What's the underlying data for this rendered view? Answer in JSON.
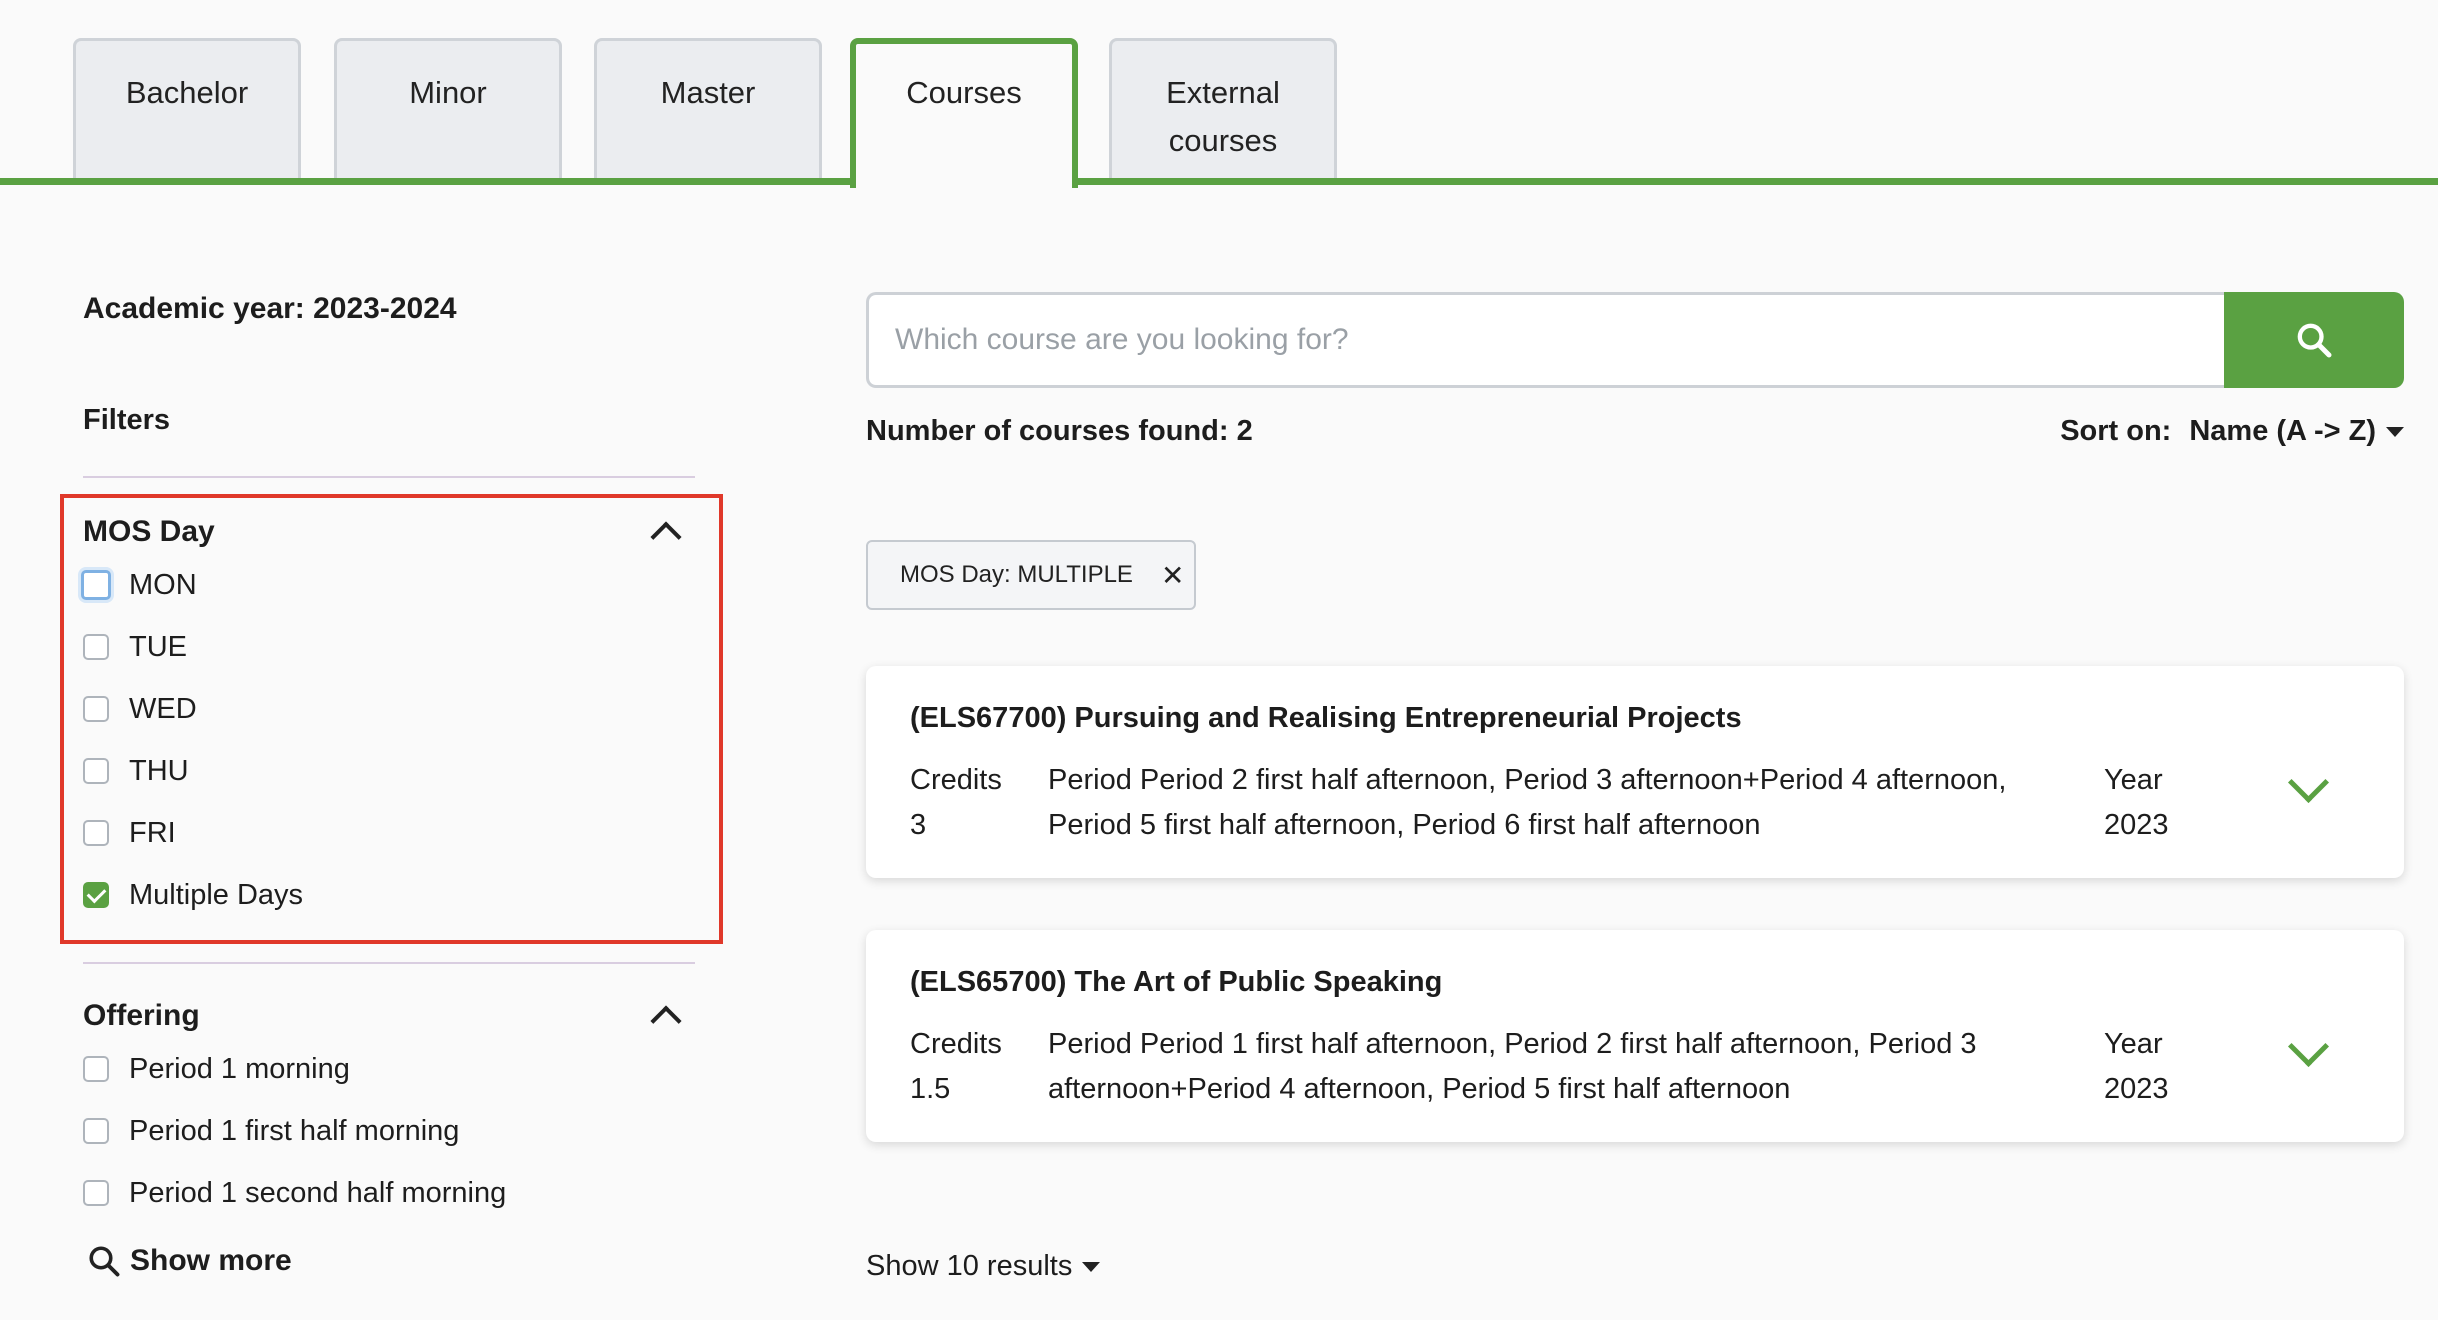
{
  "tabs": [
    {
      "label": "Bachelor"
    },
    {
      "label": "Minor"
    },
    {
      "label": "Master"
    },
    {
      "label": "Courses"
    },
    {
      "label": "External courses"
    }
  ],
  "active_tab": "Courses",
  "academic_year": "Academic year: 2023-2024",
  "filters_title": "Filters",
  "mos_day": {
    "title": "MOS Day",
    "options": [
      {
        "label": "MON",
        "checked": false
      },
      {
        "label": "TUE",
        "checked": false
      },
      {
        "label": "WED",
        "checked": false
      },
      {
        "label": "THU",
        "checked": false
      },
      {
        "label": "FRI",
        "checked": false
      },
      {
        "label": "Multiple Days",
        "checked": true
      }
    ]
  },
  "offering": {
    "title": "Offering",
    "options": [
      {
        "label": "Period 1 morning",
        "checked": false
      },
      {
        "label": "Period 1 first half morning",
        "checked": false
      },
      {
        "label": "Period 1 second half morning",
        "checked": false
      }
    ],
    "show_more": "Show more"
  },
  "search": {
    "placeholder": "Which course are you looking for?",
    "value": ""
  },
  "results_count": "Number of courses found: 2",
  "sort": {
    "label": "Sort on:",
    "value": "Name (A -> Z)"
  },
  "active_filter_chip": "MOS Day: MULTIPLE",
  "courses": [
    {
      "title": "(ELS67700) Pursuing and Realising Entrepreneurial Projects",
      "credits_label": "Credits",
      "credits": "3",
      "period_line1": "Period Period 2 first half afternoon, Period 3 afternoon+Period 4 afternoon,",
      "period_line2": "Period 5 first half afternoon, Period 6 first half afternoon",
      "year_label": "Year",
      "year": "2023"
    },
    {
      "title": "(ELS65700) The Art of Public Speaking",
      "credits_label": "Credits",
      "credits": "1.5",
      "period_line1": "Period Period 1 first half afternoon, Period 2 first half afternoon, Period 3",
      "period_line2": "afternoon+Period 4 afternoon, Period 5 first half afternoon",
      "year_label": "Year",
      "year": "2023"
    }
  ],
  "show_results": "Show 10 results",
  "colors": {
    "accent": "#5aa142",
    "highlight": "#e0382a"
  }
}
